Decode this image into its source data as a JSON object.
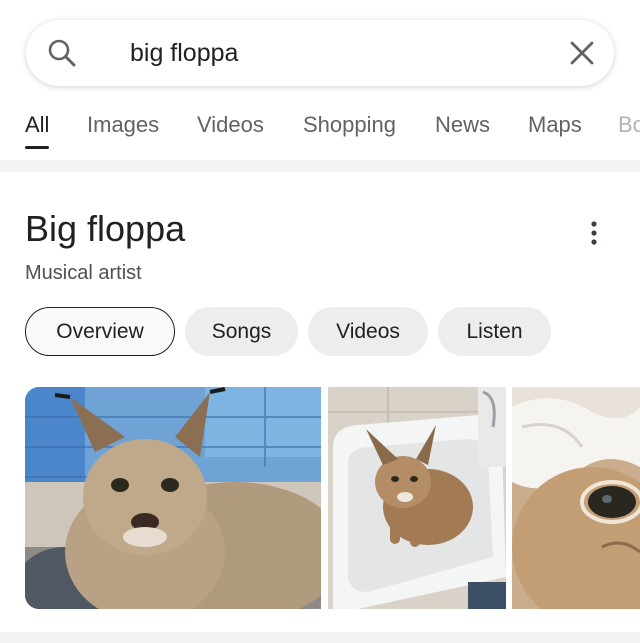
{
  "search": {
    "query": "big floppa"
  },
  "tabs": [
    {
      "label": "All",
      "active": true
    },
    {
      "label": "Images"
    },
    {
      "label": "Videos"
    },
    {
      "label": "Shopping"
    },
    {
      "label": "News"
    },
    {
      "label": "Maps"
    },
    {
      "label": "Bo"
    }
  ],
  "knowledge_panel": {
    "title": "Big floppa",
    "subtitle": "Musical artist",
    "chips": [
      {
        "label": "Overview",
        "selected": true
      },
      {
        "label": "Songs"
      },
      {
        "label": "Videos"
      },
      {
        "label": "Listen"
      }
    ],
    "images": [
      {
        "icon": "caracal-photo-sitting"
      },
      {
        "icon": "caracal-photo-bathtub"
      },
      {
        "icon": "caracal-photo-closeup"
      }
    ]
  },
  "colors": {
    "text": "#202124",
    "secondary_text": "#5f6368",
    "chip_bg": "#ebedef",
    "divider": "#f1f3f4"
  }
}
